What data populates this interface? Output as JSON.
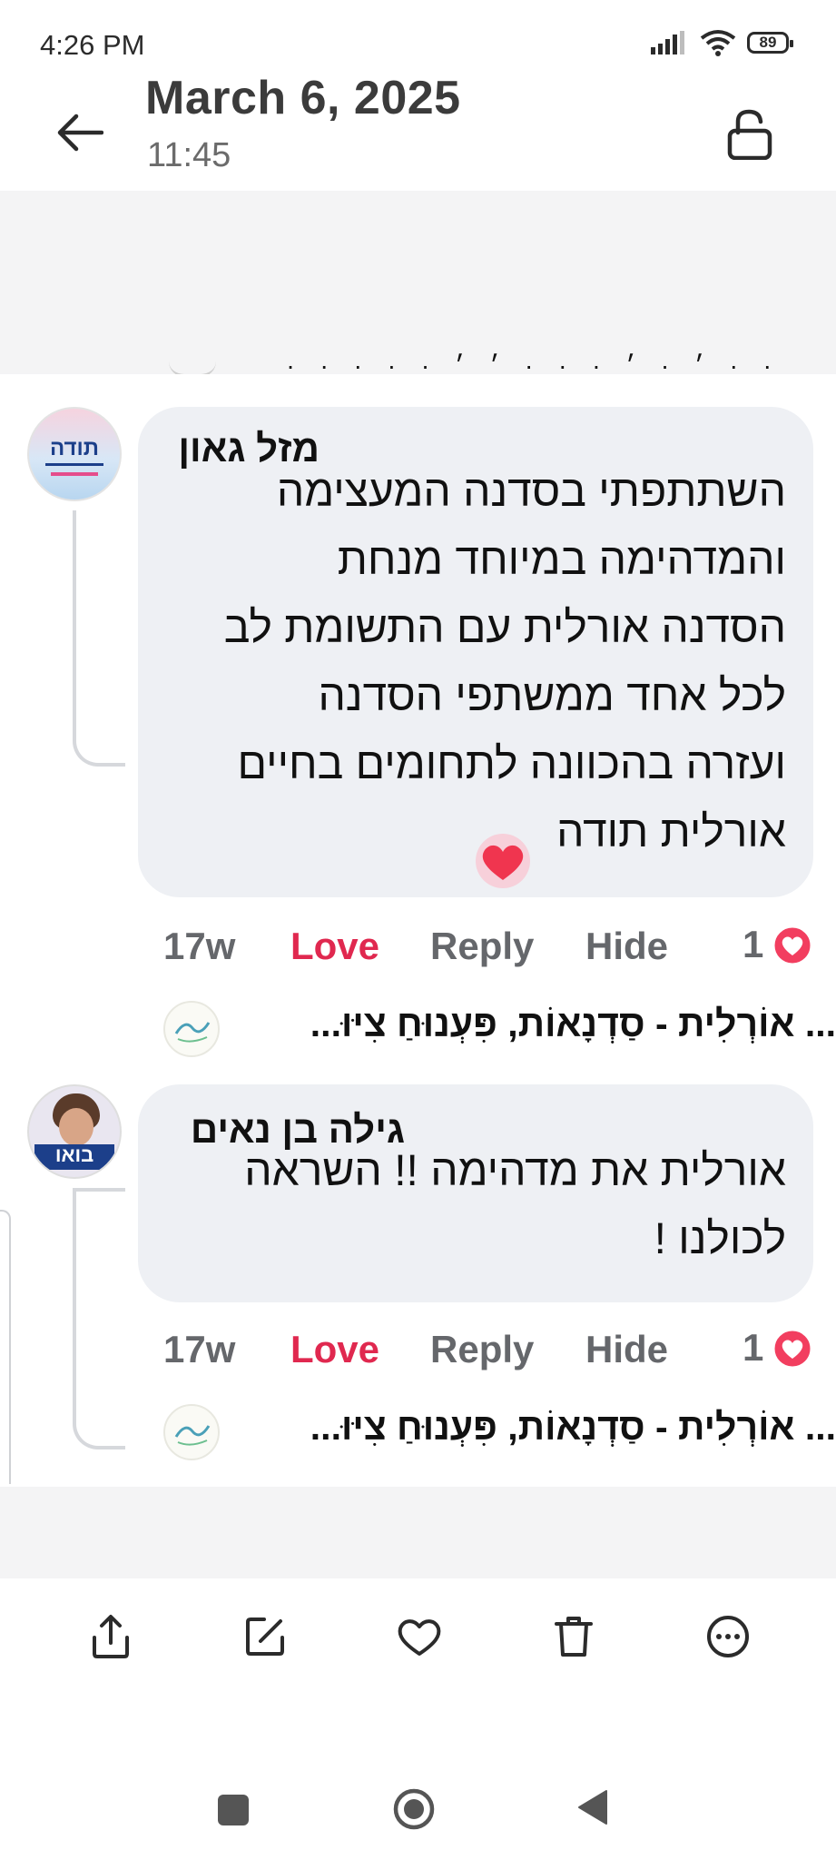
{
  "status_bar": {
    "time": "4:26 PM",
    "battery": "89"
  },
  "header": {
    "date": "March 6, 2025",
    "time": "11:45"
  },
  "comments": [
    {
      "author": "מזל גאון",
      "avatar_text": "תודה",
      "text_lines": [
        "השתתפתי בסדנה המעצימה",
        "והמדהימה במיוחד מנחת",
        "הסדנה אורלית עם התשומת לב",
        "לכל אחד ממשתפי הסדנה",
        "ועזרה בהכוונה לתחומים בחיים",
        "אורלית תודה"
      ],
      "time_ago": "17w",
      "love": "Love",
      "reply": "Reply",
      "hide": "Hide",
      "reactions": "1",
      "reply_preview": "... אוֹרְלִית - סַדְנָאוֹת, פִּעְנוּחַ צִיּוּ..."
    },
    {
      "author": "גילה בן נאים",
      "avatar_text": "בואו",
      "text_lines": [
        "אורלית את מדהימה !! השראה",
        "לכולנו !"
      ],
      "time_ago": "17w",
      "love": "Love",
      "reply": "Reply",
      "hide": "Hide",
      "reactions": "1",
      "reply_preview": "... אוֹרְלִית - סַדְנָאוֹת, פִּעְנוּחַ צִיּוּ..."
    }
  ],
  "toolbar_icons": [
    "share-icon",
    "edit-icon",
    "heart-icon",
    "trash-icon",
    "more-icon"
  ],
  "nav_icons": [
    "recents-icon",
    "home-icon",
    "back-icon"
  ],
  "colors": {
    "love": "#e0284f",
    "bubble": "#eef0f4",
    "muted": "#65676b"
  }
}
